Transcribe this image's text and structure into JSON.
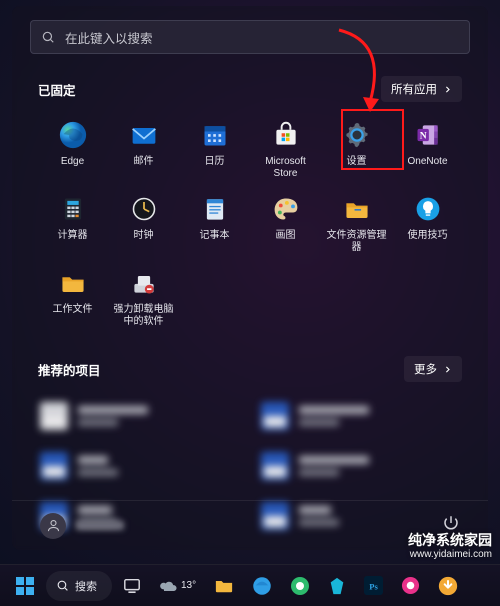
{
  "search": {
    "placeholder": "在此键入以搜索"
  },
  "pinned": {
    "title": "已固定",
    "all_apps_label": "所有应用",
    "apps": [
      {
        "id": "edge",
        "label": "Edge"
      },
      {
        "id": "mail",
        "label": "邮件"
      },
      {
        "id": "calendar",
        "label": "日历"
      },
      {
        "id": "store",
        "label": "Microsoft Store"
      },
      {
        "id": "settings",
        "label": "设置"
      },
      {
        "id": "onenote",
        "label": "OneNote"
      },
      {
        "id": "calculator",
        "label": "计算器"
      },
      {
        "id": "clock",
        "label": "时钟"
      },
      {
        "id": "notepad",
        "label": "记事本"
      },
      {
        "id": "paint",
        "label": "画图"
      },
      {
        "id": "explorer",
        "label": "文件资源管理器"
      },
      {
        "id": "tips",
        "label": "使用技巧"
      },
      {
        "id": "workfiles",
        "label": "工作文件"
      },
      {
        "id": "uninstall",
        "label": "强力卸载电脑中的软件"
      }
    ]
  },
  "recommended": {
    "title": "推荐的项目",
    "more_label": "更多"
  },
  "taskbar": {
    "search_label": "搜索",
    "weather_temp": "13°"
  },
  "watermark": {
    "line1": "纯净系统家园",
    "line2": "www.yidaimei.com"
  },
  "colors": {
    "highlight": "#ff1a1a",
    "edge": "#2f9ee6",
    "mail": "#0f6fd1",
    "calendar": "#1f6fd6",
    "store": "#ffffff",
    "settings_ring": "#3aa1ea",
    "onenote": "#7b2aa8",
    "folder": "#f3b73e",
    "tips": "#19a0e6"
  }
}
